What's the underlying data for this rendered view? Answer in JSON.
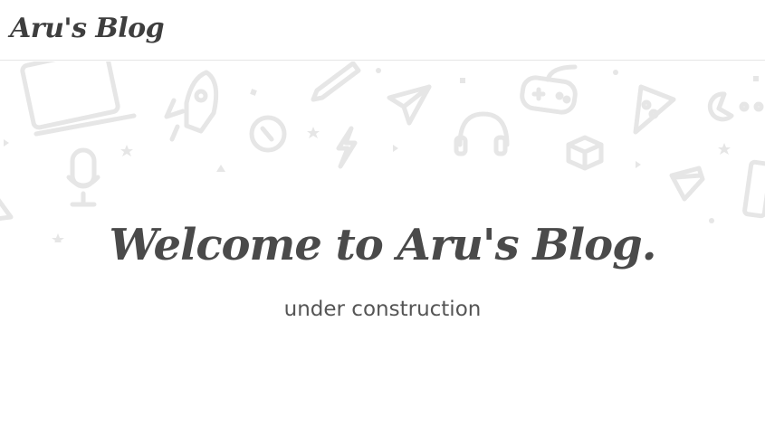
{
  "navbar": {
    "brand": "Aru's Blog"
  },
  "hero": {
    "title": "Welcome to Aru's Blog.",
    "subtitle": "under construction"
  },
  "background_icons": [
    "laptop-icon",
    "rocket-icon",
    "pencil-icon",
    "paper-plane-icon",
    "gamepad-icon",
    "pizza-icon",
    "pacman-icon",
    "compass-icon",
    "lightning-icon",
    "headphones-icon",
    "lego-brick-icon",
    "microphone-icon",
    "diamond-icon",
    "phone-icon"
  ],
  "colors": {
    "doodle": "#e8e8e8",
    "text": "#4a4a4a",
    "border": "#e6e6e6"
  }
}
